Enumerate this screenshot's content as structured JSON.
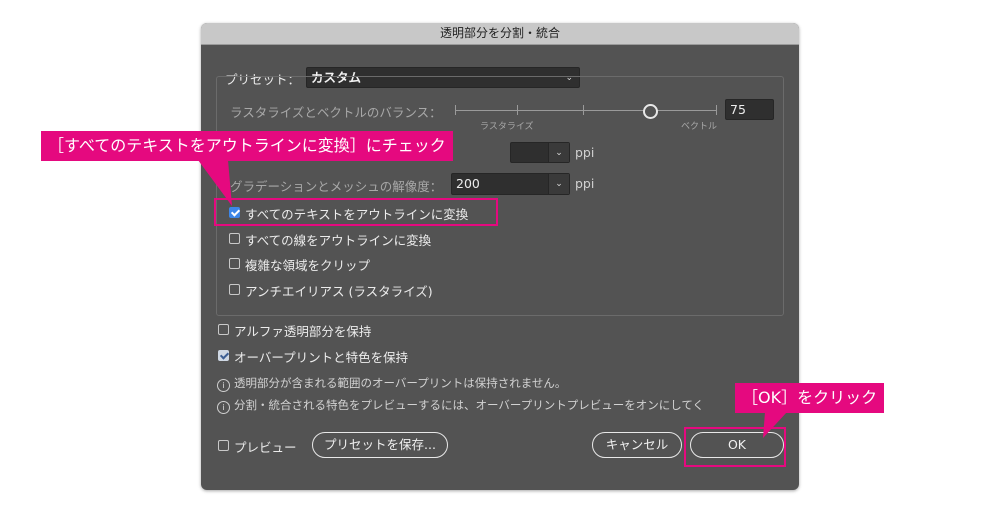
{
  "dialog": {
    "title": "透明部分を分割・統合",
    "preset_label": "プリセット：",
    "preset_value": "カスタム",
    "balance_label": "ラスタライズとベクトルのバランス：",
    "balance_left": "ラスタライズ",
    "balance_right": "ベクトル",
    "balance_value": "75",
    "text_res_unit": "ppi",
    "gradient_label": "グラデーションとメッシュの解像度：",
    "gradient_value": "200",
    "gradient_unit": "ppi",
    "options": [
      {
        "label": "すべてのテキストをアウトラインに変換",
        "checked": true
      },
      {
        "label": "すべての線をアウトラインに変換",
        "checked": false
      },
      {
        "label": "複雑な領域をクリップ",
        "checked": false
      },
      {
        "label": "アンチエイリアス (ラスタライズ)",
        "checked": false
      }
    ],
    "alpha_label": "アルファ透明部分を保持",
    "alpha_checked": false,
    "overprint_label": "オーバープリントと特色を保持",
    "overprint_checked": true,
    "info1": "透明部分が含まれる範囲のオーバープリントは保持されません。",
    "info2": "分割・統合される特色をプレビューするには、オーバープリントプレビューをオンにしてく",
    "preview_label": "プレビュー",
    "save_preset_label": "プリセットを保存...",
    "cancel_label": "キャンセル",
    "ok_label": "OK"
  },
  "callouts": {
    "top": "［すべてのテキストをアウトラインに変換］にチェック",
    "ok": "［OK］をクリック"
  },
  "colors": {
    "dialog_bg": "#535353",
    "accent_magenta": "#e5097f",
    "checkbox_blue": "#3d86e8"
  }
}
